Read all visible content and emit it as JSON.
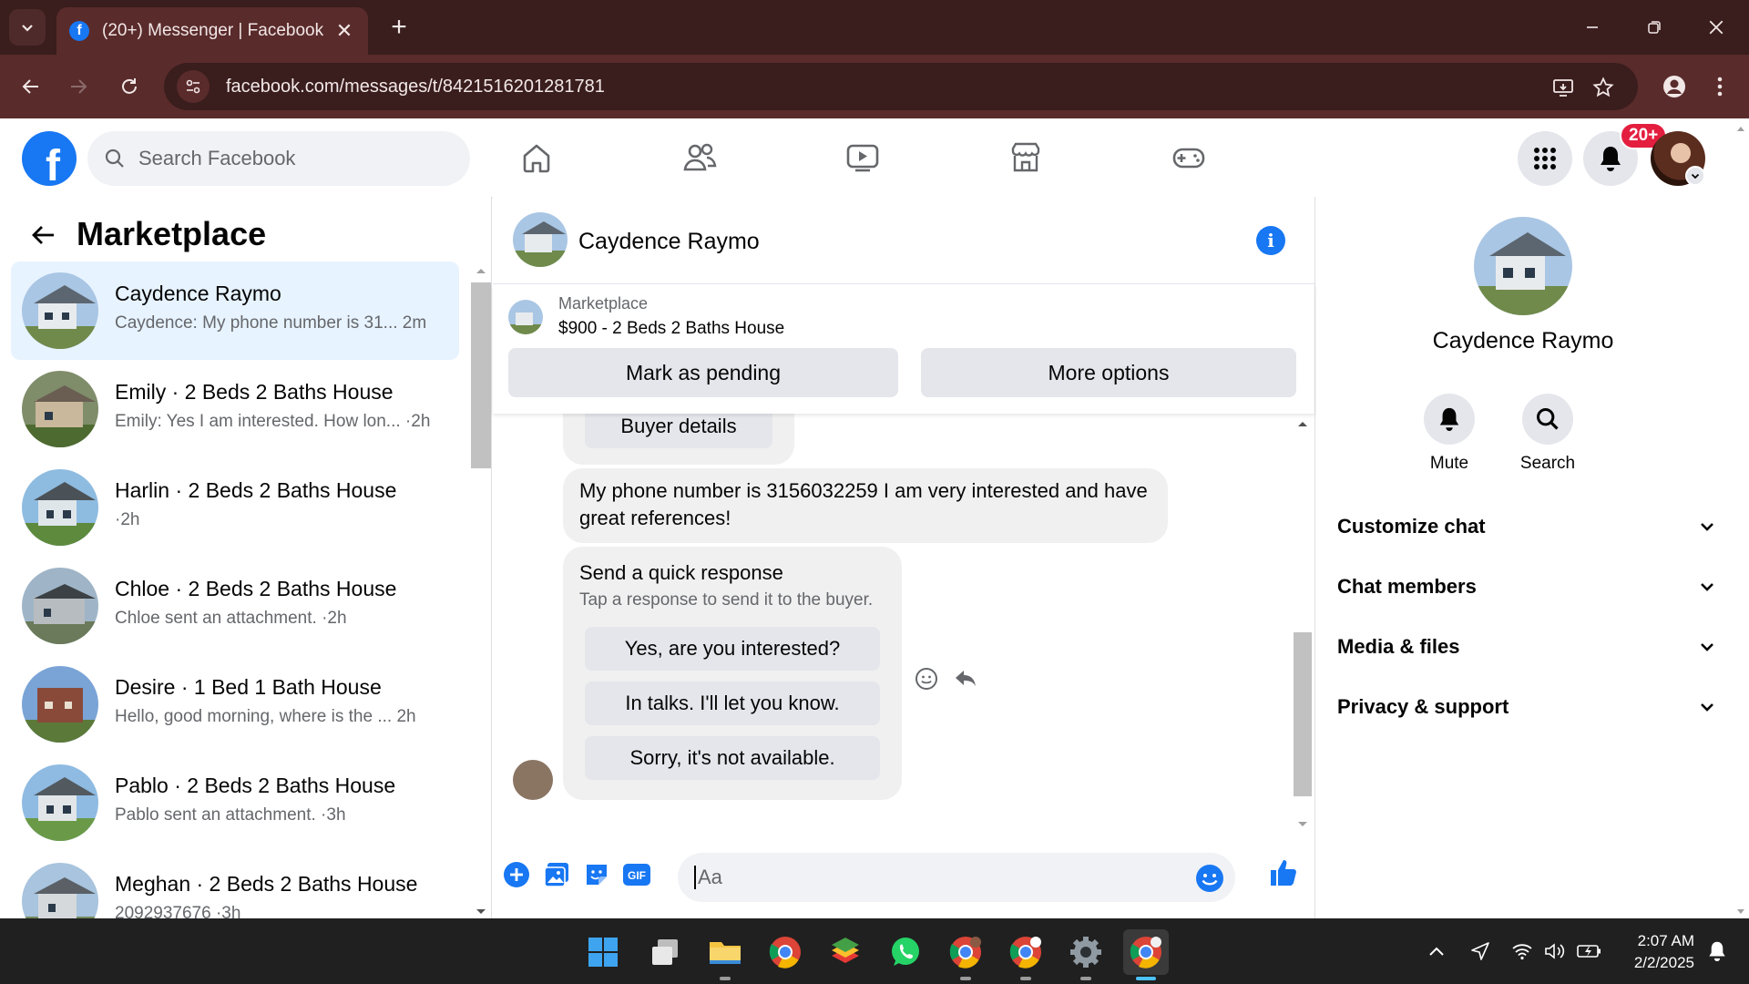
{
  "browser": {
    "tab_title": "(20+) Messenger | Facebook",
    "url": "facebook.com/messages/t/8421516201281781"
  },
  "fb": {
    "search_placeholder": "Search Facebook",
    "notification_badge": "20+"
  },
  "left": {
    "title": "Marketplace",
    "conversations": [
      {
        "name": "Caydence Raymo",
        "snippet": "Caydence: My phone number is 31...",
        "time": "2m",
        "active": true
      },
      {
        "name": "Emily · 2 Beds 2 Baths House",
        "snippet": "Emily: Yes I am interested. How lon...",
        "time": "2h"
      },
      {
        "name": "Harlin · 2 Beds 2 Baths House",
        "snippet": "",
        "time": "2h"
      },
      {
        "name": "Chloe · 2 Beds 2 Baths House",
        "snippet": "Chloe sent an attachment.",
        "time": "2h"
      },
      {
        "name": "Desire · 1 Bed 1 Bath House",
        "snippet": "Hello, good morning, where is the ...",
        "time": "2h"
      },
      {
        "name": "Pablo · 2 Beds 2 Baths House",
        "snippet": "Pablo sent an attachment.",
        "time": "3h"
      },
      {
        "name": "Meghan · 2 Beds 2 Baths House",
        "snippet": "2092937676",
        "time": "3h"
      }
    ]
  },
  "chat": {
    "contact_name": "Caydence Raymo",
    "marketplace_label": "Marketplace",
    "listing": "$900 - 2 Beds 2 Baths House",
    "mark_pending": "Mark as pending",
    "more_options": "More options",
    "buyer_details": "Buyer details",
    "message": "My phone number is 3156032259 I am very interested and have great references!",
    "quick_title": "Send a quick response",
    "quick_sub": "Tap a response to send it to the buyer.",
    "quick_responses": [
      "Yes, are you interested?",
      "In talks. I'll let you know.",
      "Sorry, it's not available."
    ],
    "composer_placeholder": "Aa"
  },
  "right": {
    "name": "Caydence Raymo",
    "mute": "Mute",
    "search": "Search",
    "sections": [
      "Customize chat",
      "Chat members",
      "Media & files",
      "Privacy & support"
    ]
  },
  "taskbar": {
    "time": "2:07 AM",
    "date": "2/2/2025"
  },
  "colors": {
    "fb_blue": "#1877f2",
    "chrome_dark": "#3a1d1d",
    "chrome_mid": "#5a2b2b",
    "badge_red": "#e41e3f"
  }
}
